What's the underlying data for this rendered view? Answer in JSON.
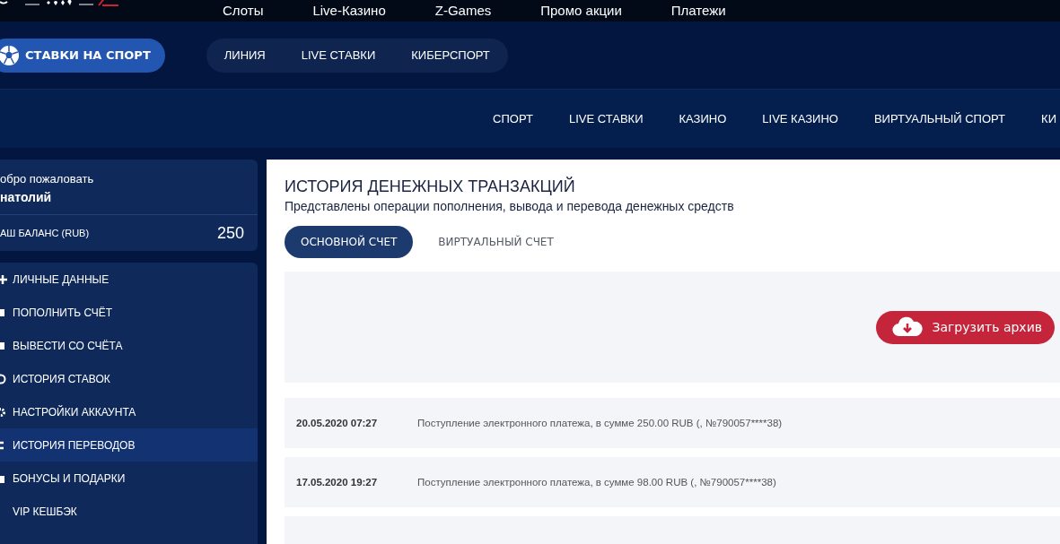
{
  "top_nav": [
    {
      "label": "Слоты"
    },
    {
      "label": "Live-Казино"
    },
    {
      "label": "Z-Games"
    },
    {
      "label": "Промо акции"
    },
    {
      "label": "Платежи"
    }
  ],
  "sport_button": {
    "label": "СТАВКИ НА СПОРТ"
  },
  "sport_tabs": [
    {
      "label": "ЛИНИЯ"
    },
    {
      "label": "LIVE СТАВКИ"
    },
    {
      "label": "КИБЕРСПОРТ"
    }
  ],
  "main_nav": [
    {
      "label": "СПОРТ"
    },
    {
      "label": "LIVE СТАВКИ"
    },
    {
      "label": "КАЗИНО"
    },
    {
      "label": "LIVE КАЗИНО"
    },
    {
      "label": "ВИРТУАЛЬНЫЙ СПОРТ"
    },
    {
      "label": "КИ"
    }
  ],
  "account": {
    "greeting": "обро пожаловать",
    "name": "натолий",
    "balance_label": "АШ БАЛАНС (RUB)",
    "balance": "250"
  },
  "sidebar": {
    "items": [
      {
        "label": "ЛИЧНЫЕ ДАННЫЕ",
        "selected": false
      },
      {
        "label": "ПОПОЛНИТЬ СЧЁТ",
        "selected": false
      },
      {
        "label": "ВЫВЕСТИ СО СЧЁТА",
        "selected": false
      },
      {
        "label": "ИСТОРИЯ СТАВОК",
        "selected": false
      },
      {
        "label": "НАСТРОЙКИ АККАУНТА",
        "selected": false
      },
      {
        "label": "ИСТОРИЯ ПЕРЕВОДОВ",
        "selected": true
      },
      {
        "label": "БОНУСЫ И ПОДАРКИ",
        "selected": false
      },
      {
        "label": "VIP КЕШБЭК",
        "selected": false
      }
    ]
  },
  "content": {
    "title": "ИСТОРИЯ ДЕНЕЖНЫХ ТРАНЗАКЦИЙ",
    "subtitle": "Представлены операции пополнения, вывода и перевода денежных средств",
    "tabs": [
      {
        "label": "ОСНОВНОЙ СЧЕТ",
        "selected": true
      },
      {
        "label": "ВИРТУАЛЬНЫЙ СЧЕТ",
        "selected": false
      }
    ],
    "download_button": {
      "label": "Загрузить архив"
    },
    "transactions": [
      {
        "date": "20.05.2020 07:27",
        "description": "Поступление электронного платежа, в сумме 250.00 RUB (, №790057****38)"
      },
      {
        "date": "17.05.2020 19:27",
        "description": "Поступление электронного платежа, в сумме 98.00 RUB (, №790057****38)"
      }
    ]
  }
}
